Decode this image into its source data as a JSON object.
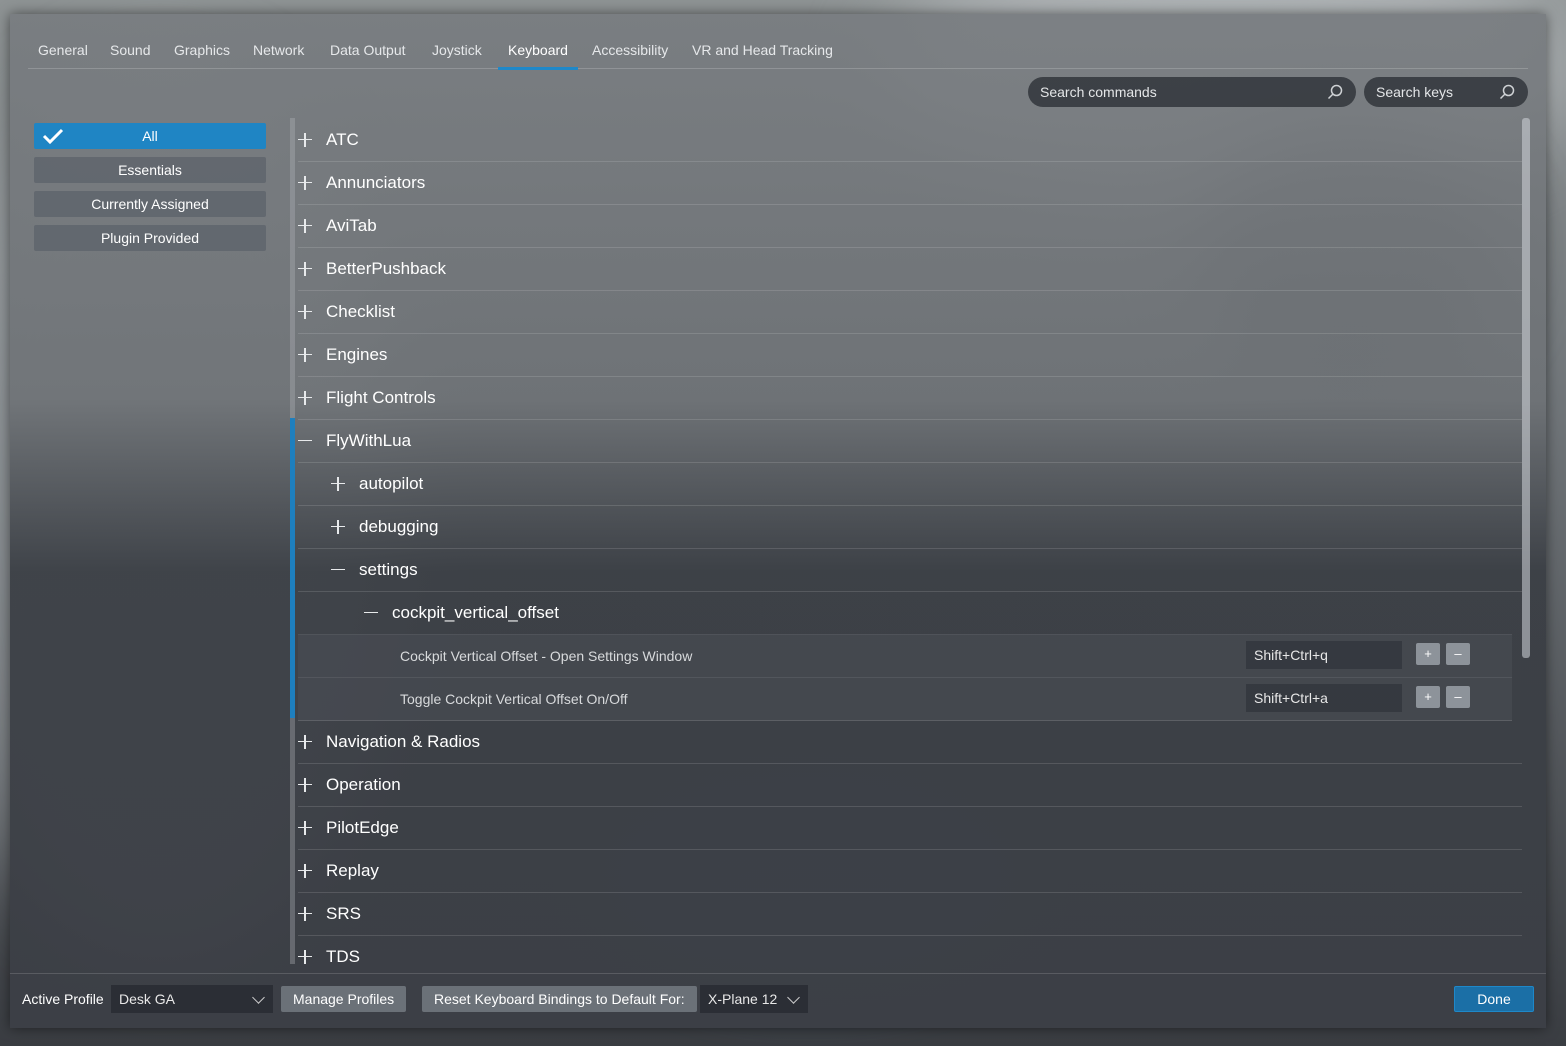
{
  "tabs": [
    {
      "label": "General"
    },
    {
      "label": "Sound"
    },
    {
      "label": "Graphics"
    },
    {
      "label": "Network"
    },
    {
      "label": "Data Output"
    },
    {
      "label": "Joystick"
    },
    {
      "label": "Keyboard"
    },
    {
      "label": "Accessibility"
    },
    {
      "label": "VR and Head Tracking"
    }
  ],
  "active_tab": "Keyboard",
  "search": {
    "commands_placeholder": "Search commands",
    "keys_placeholder": "Search keys"
  },
  "filters": [
    {
      "label": "All"
    },
    {
      "label": "Essentials"
    },
    {
      "label": "Currently Assigned"
    },
    {
      "label": "Plugin Provided"
    }
  ],
  "active_filter": "All",
  "categories": {
    "atc": "ATC",
    "annunciators": "Annunciators",
    "avitab": "AviTab",
    "betterpushback": "BetterPushback",
    "checklist": "Checklist",
    "engines": "Engines",
    "flight_controls": "Flight Controls",
    "flywithlua": "FlyWithLua",
    "autopilot": "autopilot",
    "debugging": "debugging",
    "settings": "settings",
    "cockpit_vertical_offset": "cockpit_vertical_offset",
    "navigation_radios": "Navigation & Radios",
    "operation": "Operation",
    "pilotedge": "PilotEdge",
    "replay": "Replay",
    "srs": "SRS",
    "tds": "TDS"
  },
  "commands": [
    {
      "label": "Cockpit Vertical Offset - Open Settings Window",
      "key": "Shift+Ctrl+q"
    },
    {
      "label": "Toggle Cockpit Vertical Offset On/Off",
      "key": "Shift+Ctrl+a"
    }
  ],
  "key_buttons": {
    "add": "+",
    "remove": "–"
  },
  "footer": {
    "active_profile_label": "Active Profile",
    "profile_value": "Desk GA",
    "manage_profiles": "Manage Profiles",
    "reset_label": "Reset Keyboard Bindings to Default For:",
    "reset_target": "X-Plane 12",
    "done": "Done"
  },
  "colors": {
    "accent": "#1e88c9"
  }
}
